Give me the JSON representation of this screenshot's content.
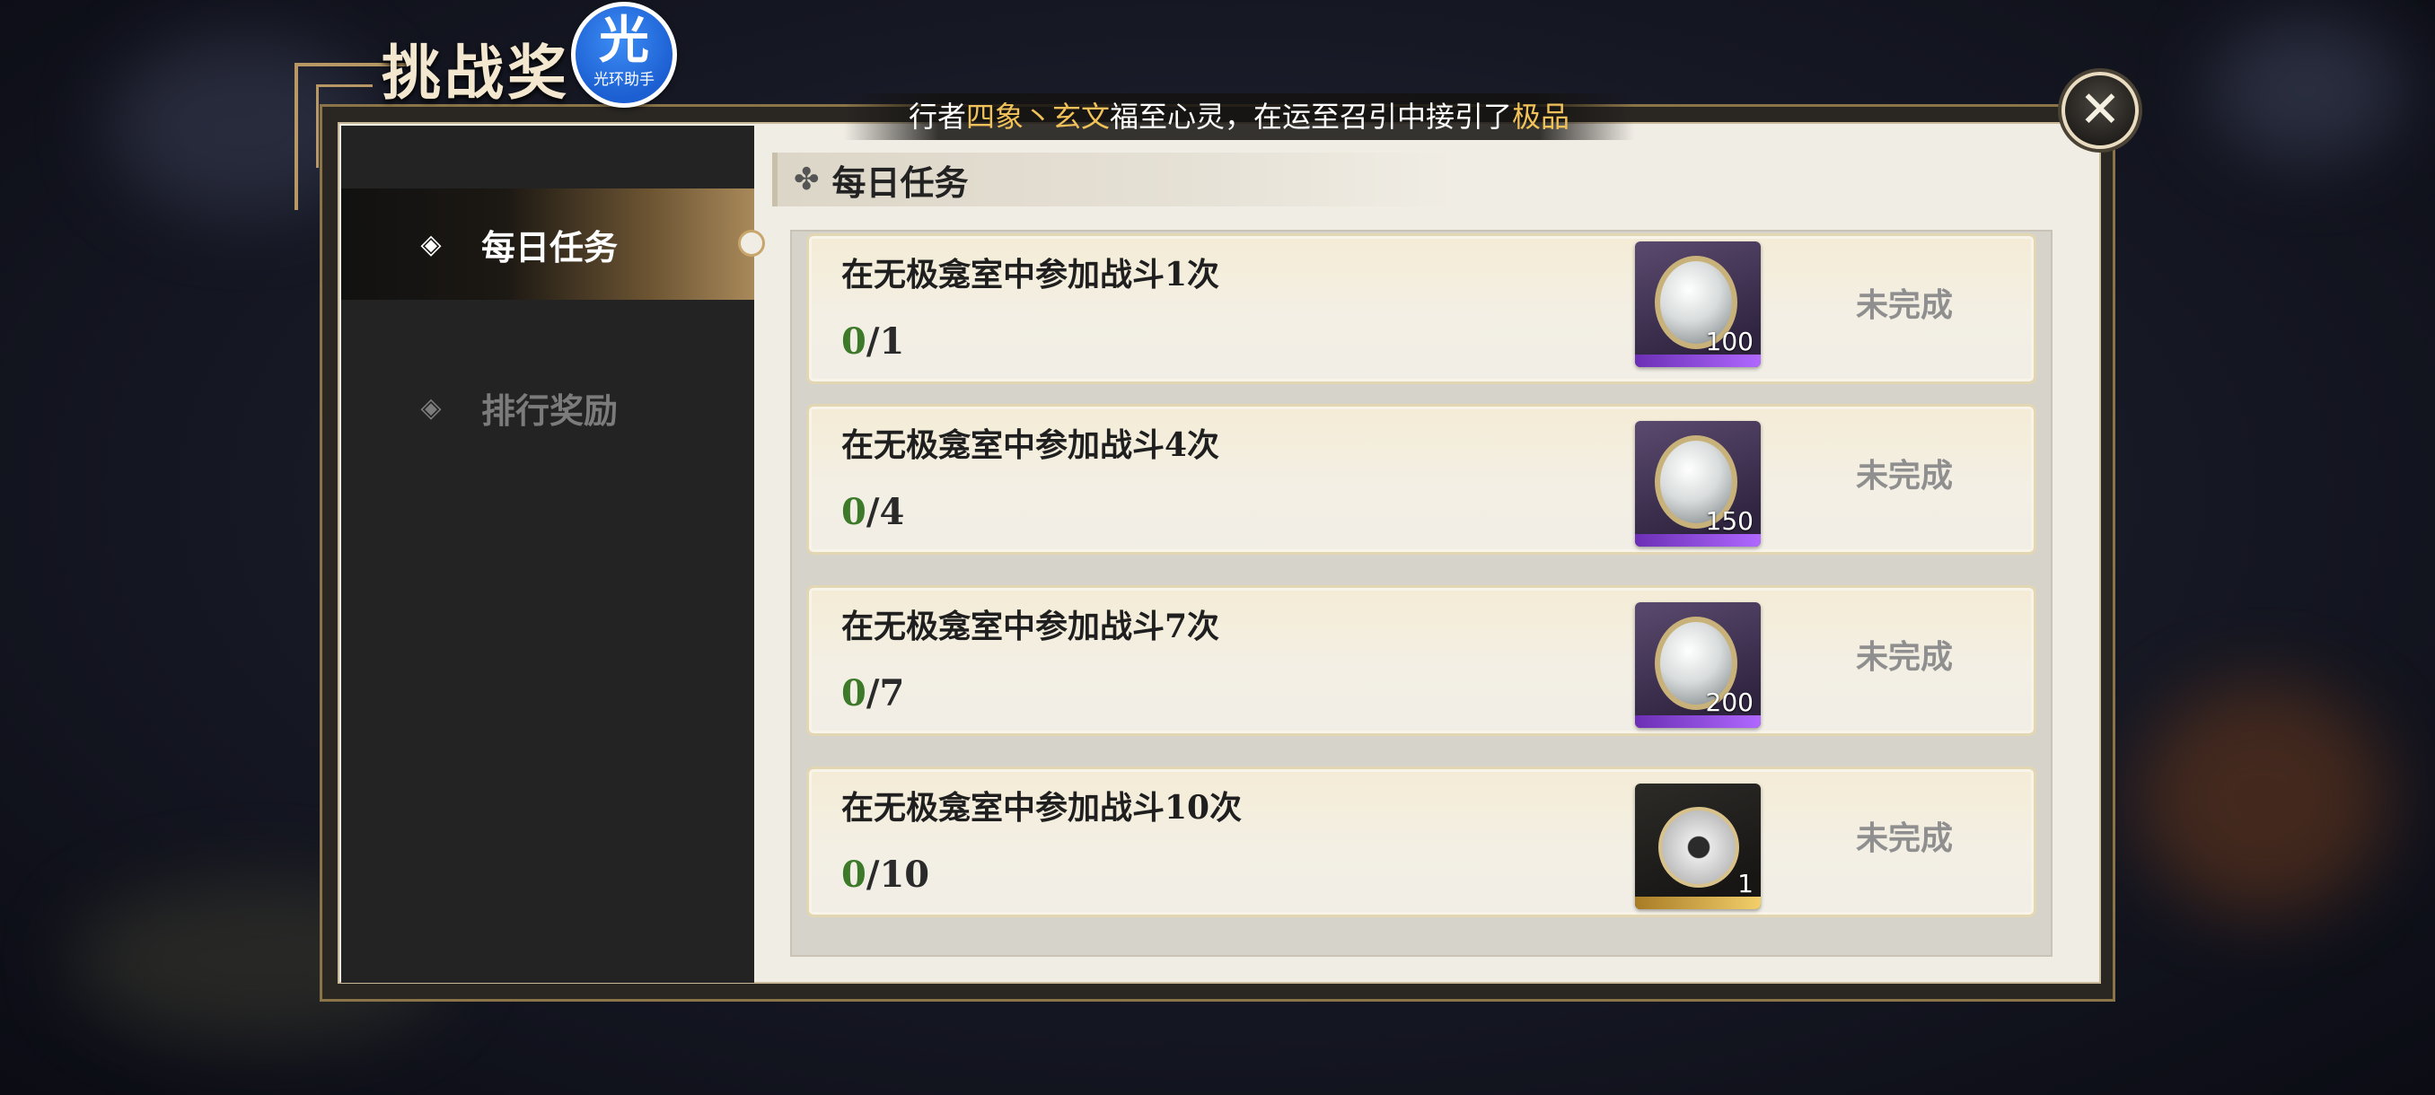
{
  "header": {
    "title": "挑战奖",
    "badge_glyph": "光",
    "badge_sub": "光环助手"
  },
  "marquee": {
    "prefix": "行者",
    "name": "四象丶玄文",
    "middle": "福至心灵，在运至召引中接引了",
    "item": "极品"
  },
  "sidebar": {
    "items": [
      {
        "label": "每日任务",
        "icon": "diamond-icon"
      },
      {
        "label": "排行奖励",
        "icon": "diamond-icon"
      }
    ]
  },
  "section": {
    "icon": "flower-icon",
    "title": "每日任务"
  },
  "tasks": [
    {
      "name": "在无极龛室中参加战斗1次",
      "current": "0",
      "total": "/1",
      "reward_count": "100",
      "reward_icon": "mirror-icon",
      "status": "未完成"
    },
    {
      "name": "在无极龛室中参加战斗4次",
      "current": "0",
      "total": "/4",
      "reward_count": "150",
      "reward_icon": "mirror-icon",
      "status": "未完成"
    },
    {
      "name": "在无极龛室中参加战斗7次",
      "current": "0",
      "total": "/7",
      "reward_count": "200",
      "reward_icon": "mirror-icon",
      "status": "未完成"
    },
    {
      "name": "在无极龛室中参加战斗10次",
      "current": "0",
      "total": "/10",
      "reward_count": "1",
      "reward_icon": "token-icon",
      "status": "未完成"
    }
  ],
  "colors": {
    "progress_current": "#3c7a2a",
    "highlight": "#f1c25a",
    "rarity_purple": "#b068ff",
    "rarity_gold": "#f3cf6b"
  },
  "close_icon": "close-icon"
}
